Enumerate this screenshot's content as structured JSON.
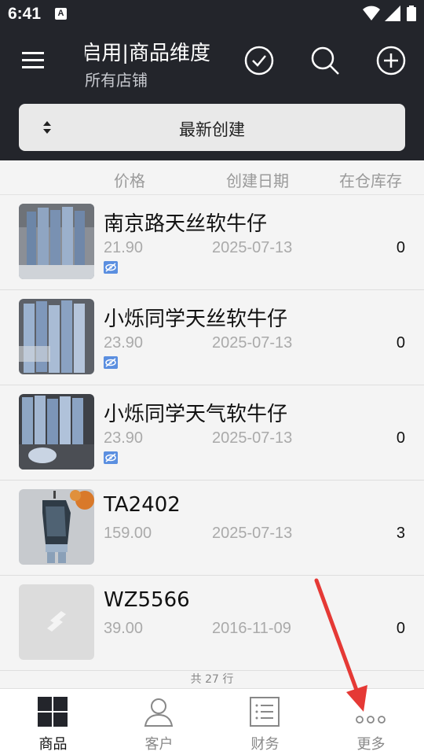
{
  "status": {
    "time": "6:41",
    "notif_icon": "a-letter-icon"
  },
  "header": {
    "title": "启用|商品维度",
    "subtitle": "所有店铺",
    "icons": [
      "menu-icon",
      "check-circle-icon",
      "search-icon",
      "plus-circle-icon"
    ]
  },
  "sort": {
    "label": "最新创建"
  },
  "columns": {
    "price": "价格",
    "created": "创建日期",
    "stock": "在仓库存"
  },
  "products": [
    {
      "name": "南京路天丝软牛仔",
      "price": "21.90",
      "date": "2025-07-13",
      "stock": "0",
      "hidden": true
    },
    {
      "name": "小烁同学天丝软牛仔",
      "price": "23.90",
      "date": "2025-07-13",
      "stock": "0",
      "hidden": true
    },
    {
      "name": "小烁同学天气软牛仔",
      "price": "23.90",
      "date": "2025-07-13",
      "stock": "0",
      "hidden": true
    },
    {
      "name": "TA2402",
      "price": "159.00",
      "date": "2025-07-13",
      "stock": "3",
      "hidden": false
    },
    {
      "name": "WZ5566",
      "price": "39.00",
      "date": "2016-11-09",
      "stock": "0",
      "hidden": false
    }
  ],
  "footer": {
    "count": "共 27 行"
  },
  "nav": [
    {
      "label": "商品",
      "icon": "grid-icon",
      "active": true
    },
    {
      "label": "客户",
      "icon": "person-icon",
      "active": false
    },
    {
      "label": "财务",
      "icon": "list-doc-icon",
      "active": false
    },
    {
      "label": "更多",
      "icon": "more-dots-icon",
      "active": false
    }
  ],
  "colors": {
    "header_bg": "#23252b",
    "accent_arrow": "#e53935",
    "hidden_badge": "#5b8fe0"
  }
}
